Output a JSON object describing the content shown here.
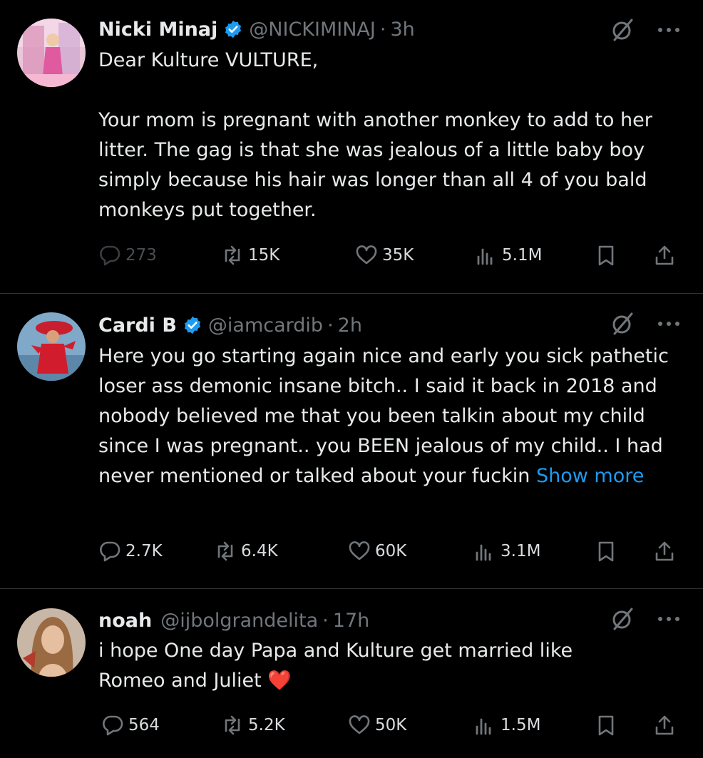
{
  "tweets": [
    {
      "name": "Nicki Minaj",
      "verified": true,
      "handle": "@NICKIMINAJ",
      "time": "3h",
      "text": "Dear Kulture VULTURE,\n\nYour mom is pregnant with another monkey to add to her litter. The gag is that she was jealous of a little baby boy simply because his hair was longer than all 4 of you bald monkeys put together.",
      "show_more": "",
      "replies": "273",
      "reposts": "15K",
      "likes": "35K",
      "views": "5.1M"
    },
    {
      "name": "Cardi B",
      "verified": true,
      "handle": "@iamcardib",
      "time": "2h",
      "text": "Here you go starting again nice and early you sick pathetic loser ass demonic insane bitch.. I said it back in 2018 and nobody believed me that you been talkin about my child since I was pregnant.. you BEEN jealous of my child.. I had never mentioned or talked about your fuckin ",
      "show_more": "Show more",
      "replies": "2.7K",
      "reposts": "6.4K",
      "likes": "60K",
      "views": "3.1M"
    },
    {
      "name": "noah",
      "verified": false,
      "handle": "@ijbolgrandelita",
      "time": "17h",
      "text": "i hope One day Papa and Kulture get married like Romeo and Juliet ",
      "emoji": "❤️",
      "show_more": "",
      "replies": "564",
      "reposts": "5.2K",
      "likes": "50K",
      "views": "1.5M"
    }
  ],
  "dot": "·",
  "colors": {
    "background": "#000000",
    "text": "#e7e9ea",
    "muted": "#71767b",
    "link": "#1d9bf0",
    "verified": "#1d9bf0",
    "heart": "#f91880"
  },
  "icons": [
    "verified-badge-icon",
    "grok-icon",
    "more-icon",
    "reply-icon",
    "repost-icon",
    "like-icon",
    "views-icon",
    "bookmark-icon",
    "share-icon"
  ]
}
